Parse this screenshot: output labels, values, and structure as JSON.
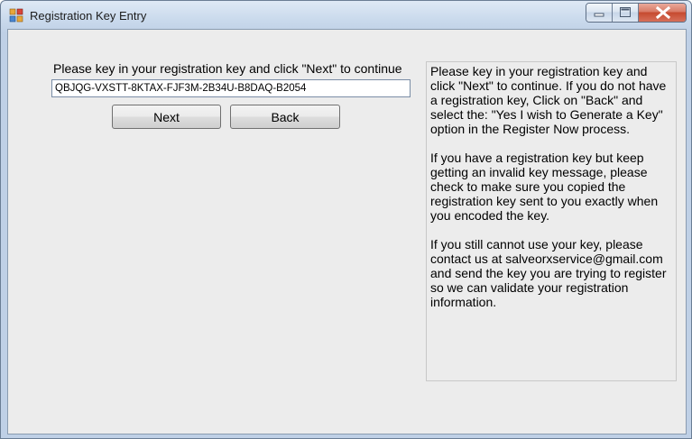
{
  "window": {
    "title": "Registration Key Entry"
  },
  "form": {
    "prompt": "Please key in your registration key and click \"Next\" to continue",
    "key_value": "QBJQG-VXSTT-8KTAX-FJF3M-2B34U-B8DAQ-B2054",
    "next_label": "Next",
    "back_label": "Back"
  },
  "info": {
    "paragraphs": [
      "Please key in your registration key and click \"Next\" to continue. If you do not have a registration key, Click on \"Back\" and select the: \"Yes I wish to Generate a Key\" option in the Register Now process.",
      "If you have a registration key but keep getting an invalid key message, please check to make sure you copied the registration key sent to you exactly when you encoded the key.",
      "If you still cannot use your key, please contact us at salveorxservice@gmail.com and send the key you are trying to register so we can validate your registration information."
    ]
  },
  "icons": {
    "app": "application-icon",
    "minimize": "minimize-icon",
    "maximize": "maximize-icon",
    "close": "close-icon"
  },
  "colors": {
    "title_bar": "#c9d9ec",
    "close_button": "#c64a2f",
    "client_background": "#ececec"
  }
}
